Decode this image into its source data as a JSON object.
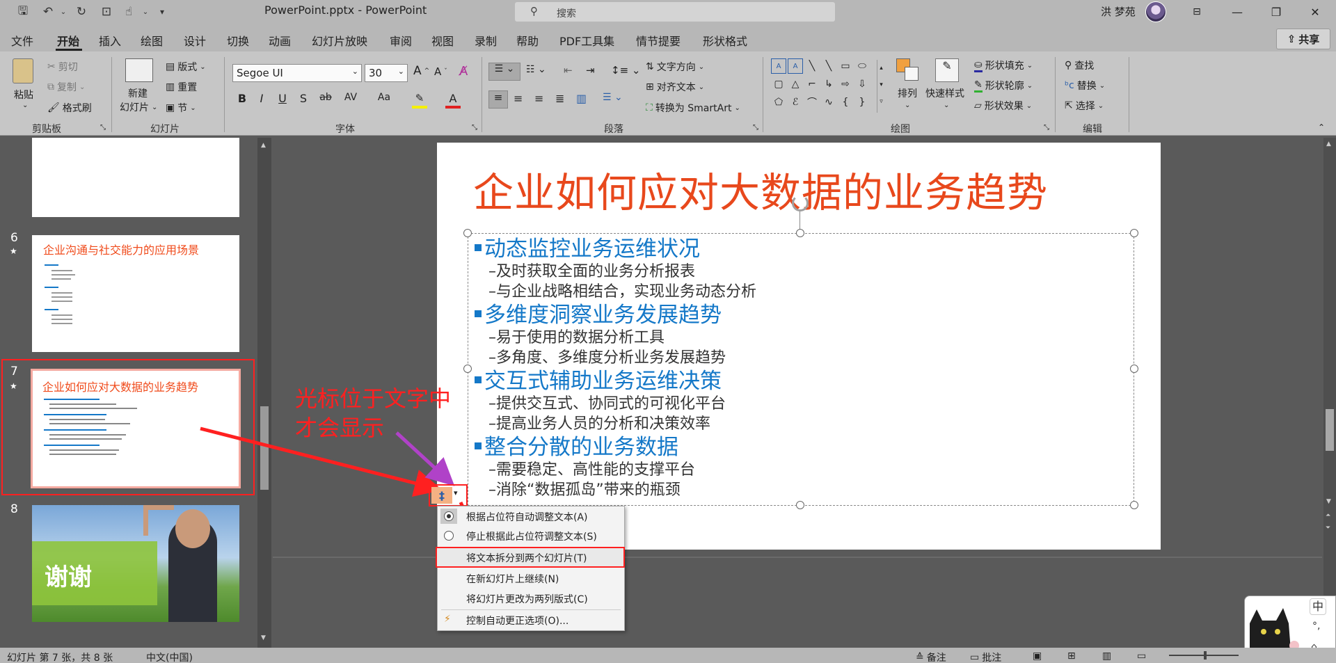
{
  "titlebar": {
    "doc_title": "PowerPoint.pptx  -  PowerPoint",
    "search_placeholder": "搜索",
    "user": "洪 梦苑"
  },
  "menu": {
    "tabs": [
      "文件",
      "开始",
      "插入",
      "绘图",
      "设计",
      "切换",
      "动画",
      "幻灯片放映",
      "审阅",
      "视图",
      "录制",
      "帮助",
      "PDF工具集",
      "情节提要",
      "形状格式"
    ],
    "active": "开始",
    "share": "共享"
  },
  "ribbon": {
    "clipboard": {
      "paste": "粘贴",
      "cut": "剪切",
      "copy": "复制",
      "format_painter": "格式刷",
      "group": "剪贴板"
    },
    "slides": {
      "new_slide_1": "新建",
      "new_slide_2": "幻灯片",
      "layout": "版式",
      "reset": "重置",
      "section": "节",
      "group": "幻灯片"
    },
    "font": {
      "family": "Segoe UI",
      "size": "30",
      "group": "字体"
    },
    "paragraph": {
      "text_direction": "文字方向",
      "align_text": "对齐文本",
      "smartart": "转换为 SmartArt",
      "group": "段落"
    },
    "drawing": {
      "arrange": "排列",
      "quick_styles": "快速样式",
      "shape_fill": "形状填充",
      "shape_outline": "形状轮廓",
      "shape_effects": "形状效果",
      "group": "绘图"
    },
    "editing": {
      "find": "查找",
      "replace": "替换",
      "select": "选择",
      "group": "编辑"
    }
  },
  "thumbnails": {
    "slide6": {
      "num": "6",
      "title": "企业沟通与社交能力的应用场景"
    },
    "slide7": {
      "num": "7",
      "title": "企业如何应对大数据的业务趋势"
    },
    "slide8": {
      "num": "8",
      "thanks": "谢谢"
    }
  },
  "slide": {
    "title": "企业如何应对大数据的业务趋势",
    "bullets": [
      {
        "text": "动态监控业务运维状况",
        "subs": [
          "–及时获取全面的业务分析报表",
          "–与企业战略相结合，实现业务动态分析"
        ]
      },
      {
        "text": "多维度洞察业务发展趋势",
        "subs": [
          "–易于使用的数据分析工具",
          "–多角度、多维度分析业务发展趋势"
        ]
      },
      {
        "text": "交互式辅助业务运维决策",
        "subs": [
          "–提供交互式、协同式的可视化平台",
          "–提高业务人员的分析和决策效率"
        ]
      },
      {
        "text": "整合分散的业务数据",
        "subs": [
          "–需要稳定、高性能的支撑平台",
          "–消除“数据孤岛”带来的瓶颈"
        ]
      }
    ]
  },
  "annotation": {
    "line1": "光标位于文字中",
    "line2": "才会显示"
  },
  "autofit_menu": [
    "根据占位符自动调整文本(A)",
    "停止根据此占位符调整文本(S)",
    "将文本拆分到两个幻灯片(T)",
    "在新幻灯片上继续(N)",
    "将幻灯片更改为两列版式(C)",
    "控制自动更正选项(O)..."
  ],
  "statusbar": {
    "slide_info": "幻灯片 第 7 张，共 8 张",
    "language": "中文(中国)",
    "notes": "备注",
    "comments": "批注"
  },
  "ime": {
    "mode": "中"
  },
  "colors": {
    "accent_red": "#e8481c",
    "bullet_blue": "#1478c8",
    "annot_red": "#ff2020"
  }
}
